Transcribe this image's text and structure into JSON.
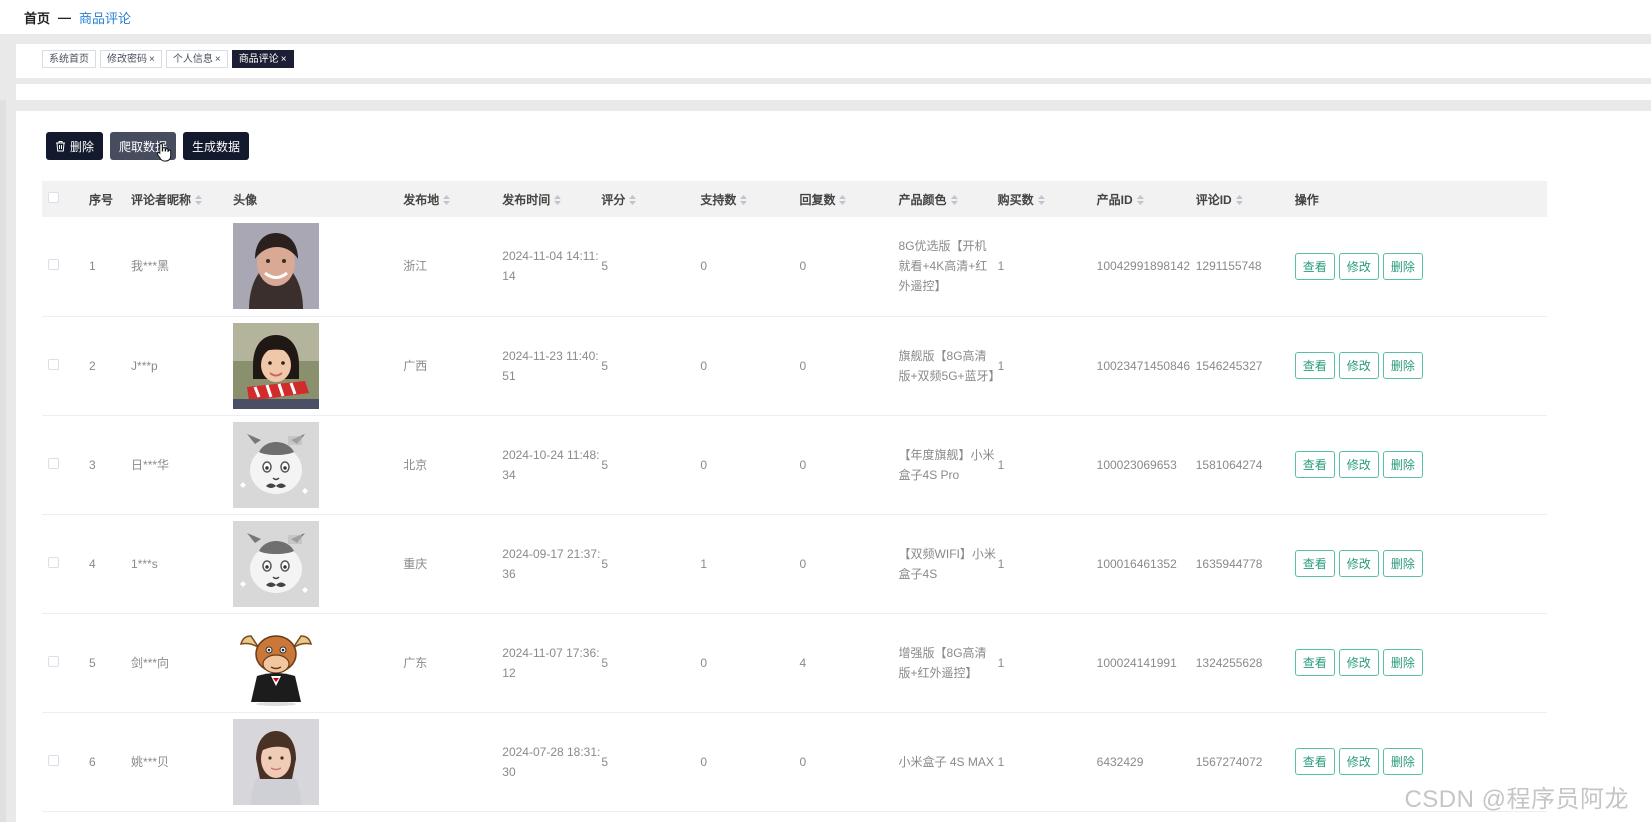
{
  "breadcrumb": {
    "home": "首页",
    "separator": "—",
    "current": "商品评论"
  },
  "tabs": [
    {
      "label": "系统首页",
      "closable": false,
      "active": false
    },
    {
      "label": "修改密码",
      "closable": true,
      "active": false
    },
    {
      "label": "个人信息",
      "closable": true,
      "active": false
    },
    {
      "label": "商品评论",
      "closable": true,
      "active": true
    }
  ],
  "tab_close_glyph": "×",
  "toolbar": {
    "delete_label": "删除",
    "crawl_label": "爬取数据",
    "generate_label": "生成数据"
  },
  "table": {
    "headers": {
      "index": "序号",
      "nickname": "评论者昵称",
      "avatar": "头像",
      "location": "发布地",
      "time": "发布时间",
      "score": "评分",
      "likes": "支持数",
      "replies": "回复数",
      "color": "产品颜色",
      "buy_count": "购买数",
      "product_id": "产品ID",
      "comment_id": "评论ID",
      "actions": "操作"
    },
    "action_labels": {
      "view": "查看",
      "edit": "修改",
      "delete": "删除"
    },
    "rows": [
      {
        "index": "1",
        "nickname": "我***黑",
        "location": "浙江",
        "time": "2024-11-04 14:11:14",
        "score": "5",
        "likes": "0",
        "replies": "0",
        "color": "8G优选版【开机就看+4K高清+红外遥控】",
        "buy_count": "1",
        "product_id": "10042991898142",
        "comment_id": "1291155748",
        "avatar": "photo-woman"
      },
      {
        "index": "2",
        "nickname": "J***p",
        "location": "广西",
        "time": "2024-11-23 11:40:51",
        "score": "5",
        "likes": "0",
        "replies": "0",
        "color": "旗舰版【8G高清版+双频5G+蓝牙】",
        "buy_count": "1",
        "product_id": "10023471450846",
        "comment_id": "1546245327",
        "avatar": "photo-child"
      },
      {
        "index": "3",
        "nickname": "日***华",
        "location": "北京",
        "time": "2024-10-24 11:48:34",
        "score": "5",
        "likes": "0",
        "replies": "0",
        "color": "【年度旗舰】小米盒子4S Pro",
        "buy_count": "1",
        "product_id": "100023069653",
        "comment_id": "1581064274",
        "avatar": "default-cow"
      },
      {
        "index": "4",
        "nickname": "1***s",
        "location": "重庆",
        "time": "2024-09-17 21:37:36",
        "score": "5",
        "likes": "1",
        "replies": "0",
        "color": "【双频WIFI】小米盒子4S",
        "buy_count": "1",
        "product_id": "100016461352",
        "comment_id": "1635944778",
        "avatar": "default-cow"
      },
      {
        "index": "5",
        "nickname": "剑***向",
        "location": "广东",
        "time": "2024-11-07 17:36:12",
        "score": "5",
        "likes": "0",
        "replies": "4",
        "color": "增强版【8G高清版+红外遥控】",
        "buy_count": "1",
        "product_id": "100024141991",
        "comment_id": "1324255628",
        "avatar": "cartoon-bull"
      },
      {
        "index": "6",
        "nickname": "姚***贝",
        "location": "",
        "time": "2024-07-28 18:31:30",
        "score": "5",
        "likes": "0",
        "replies": "0",
        "color": "小米盒子 4S MAX",
        "buy_count": "1",
        "product_id": "6432429",
        "comment_id": "1567274072",
        "avatar": "photo-woman-2"
      }
    ]
  },
  "watermark": "CSDN @程序员阿龙",
  "colors": {
    "dark_button": "#141a2e",
    "accent_link": "#2a7fd4",
    "action_green": "#2a9b7d"
  }
}
